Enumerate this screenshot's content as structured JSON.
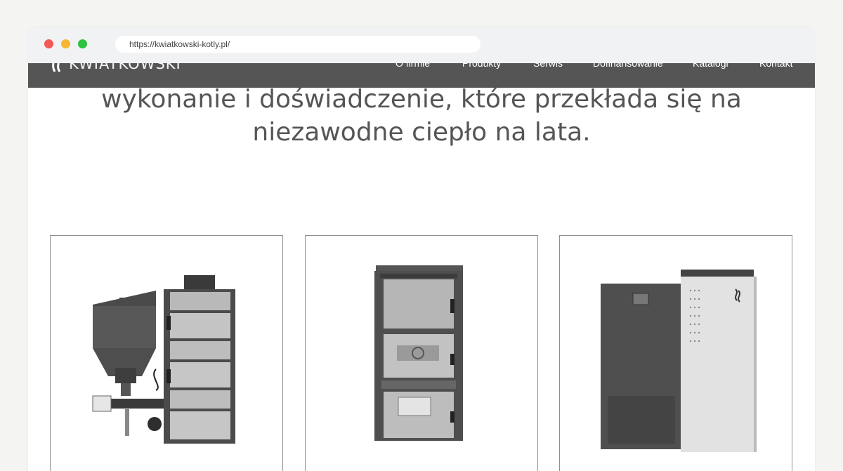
{
  "browser": {
    "url": "https://kwiatkowski-kotly.pl/"
  },
  "navbar": {
    "logo_text": "KWIATKOWSKI",
    "items": [
      {
        "label": "O firmie"
      },
      {
        "label": "Produkty"
      },
      {
        "label": "Serwis"
      },
      {
        "label": "Dofinansowanie"
      },
      {
        "label": "Katalogi"
      },
      {
        "label": "Kontakt"
      }
    ]
  },
  "hero": {
    "line1": "wykonanie i doświadczenie, które przekłada się na",
    "line2": "niezawodne ciepło na lata."
  },
  "products": [
    {
      "image": "automatic-boiler-with-fuel-hopper"
    },
    {
      "image": "manual-solid-fuel-boiler"
    },
    {
      "image": "pellet-boiler-cabinet"
    }
  ],
  "colors": {
    "navbar": "#555555",
    "headline": "#555555",
    "page_bg": "#ffffff"
  }
}
